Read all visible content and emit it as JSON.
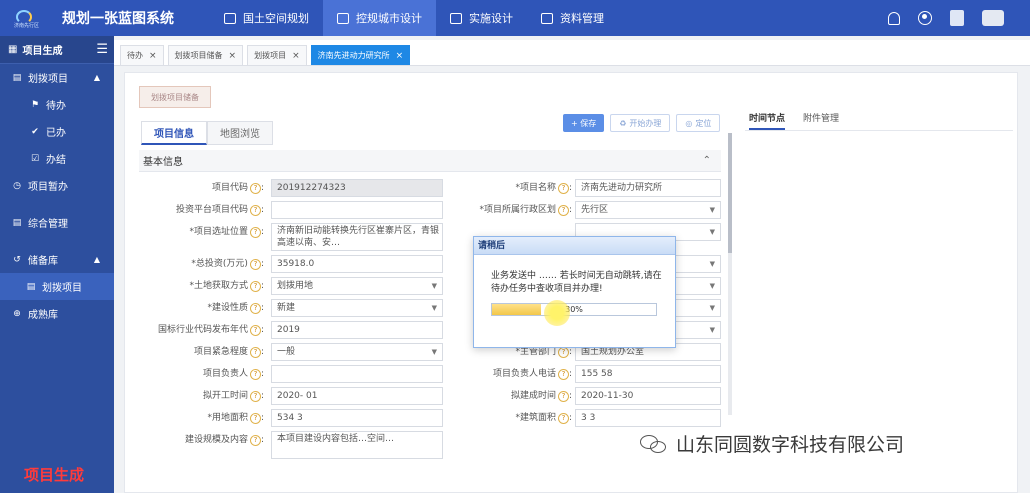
{
  "header": {
    "logo_sub": "济南先行区",
    "app_title": "规划一张蓝图系统",
    "nav": [
      {
        "label": "国土空间规划"
      },
      {
        "label": "控规城市设计"
      },
      {
        "label": "实施设计"
      },
      {
        "label": "资料管理"
      }
    ]
  },
  "sidebar": {
    "head_label": "项目生成",
    "items": [
      {
        "label": "划拨项目",
        "icon": "doc-icon"
      },
      {
        "label": "待办",
        "icon": "flag-icon"
      },
      {
        "label": "已办",
        "icon": "check-icon"
      },
      {
        "label": "办结",
        "icon": "checkbox-icon"
      },
      {
        "label": "项目暂办",
        "icon": "clock-icon"
      },
      {
        "label": "综合管理",
        "icon": "list-icon"
      },
      {
        "label": "储备库",
        "icon": "history-icon"
      },
      {
        "label": "划拨项目",
        "icon": "doc-icon"
      },
      {
        "label": "成熟库",
        "icon": "plus-circle-icon"
      }
    ],
    "watermark": "项目生成"
  },
  "tabs": [
    {
      "label": "待办"
    },
    {
      "label": "划拨项目储备"
    },
    {
      "label": "划拨项目"
    },
    {
      "label": "济南先进动力研究所"
    }
  ],
  "main": {
    "save_draft": "划拨项目储备",
    "subtabs": [
      "项目信息",
      "地图浏览"
    ],
    "actions": {
      "save": "+ 保存",
      "open": "开始办理",
      "locate": "定位"
    },
    "section_title": "基本信息",
    "side_tabs": [
      "时间节点",
      "附件管理"
    ]
  },
  "form": {
    "rows": [
      {
        "left": {
          "label": "项目代码",
          "value": "201912274323",
          "required": false,
          "grey": true
        },
        "right": {
          "label": "*项目名称",
          "value": "济南先进动力研究所",
          "select": false
        }
      },
      {
        "left": {
          "label": "投资平台项目代码",
          "value": ""
        },
        "right": {
          "label": "*项目所属行政区划",
          "value": "先行区",
          "select": true
        }
      },
      {
        "left": {
          "label": "*项目选址位置",
          "value": "济南新旧动能转换先行区崔寨片区，青银高速以南、安…",
          "tall": true
        },
        "right": {
          "label": "",
          "value": "",
          "select": true
        }
      },
      {
        "left": {
          "label": "*总投资(万元)",
          "value": "35918.0"
        },
        "right": {
          "label": "",
          "value": "",
          "select": true
        }
      },
      {
        "left": {
          "label": "*土地获取方式",
          "value": "划拨用地",
          "select": true
        },
        "right": {
          "label": "*",
          "value": "估",
          "select": true
        }
      },
      {
        "left": {
          "label": "*建设性质",
          "value": "新建",
          "select": true
        },
        "right": {
          "label": "",
          "value": "",
          "select": true
        }
      },
      {
        "left": {
          "label": "国标行业代码发布年代",
          "value": "2019"
        },
        "right": {
          "label": "",
          "value": "展",
          "select": true
        }
      },
      {
        "left": {
          "label": "项目紧急程度",
          "value": "一般",
          "select": true
        },
        "right": {
          "label": "*主管部门",
          "value": "国土规划办公室"
        }
      },
      {
        "left": {
          "label": "项目负责人",
          "value": ""
        },
        "right": {
          "label": "项目负责人电话",
          "value": "155      58"
        }
      },
      {
        "left": {
          "label": "拟开工时间",
          "value": "2020-   01"
        },
        "right": {
          "label": "拟建成时间",
          "value": "2020-11-30"
        }
      },
      {
        "left": {
          "label": "*用地面积",
          "value": "534      3"
        },
        "right": {
          "label": "*建筑面积",
          "value": "3      3"
        }
      },
      {
        "left": {
          "label": "建设规模及内容",
          "value": "本项目建设内容包括…空间…",
          "tall": true
        },
        "right": null
      }
    ]
  },
  "modal": {
    "title": "请稍后",
    "message": "业务发送中 …… 若长时间无自动跳转,请在待办任务中查收项目并办理!",
    "progress": 30,
    "progress_text": "30%"
  },
  "watermark_right": "山东同圆数字科技有限公司",
  "colors": {
    "header": "#2f55b8",
    "sidebar": "#2d4f9e",
    "tab_active": "#1e88e5",
    "progress": "#f2c74a"
  }
}
